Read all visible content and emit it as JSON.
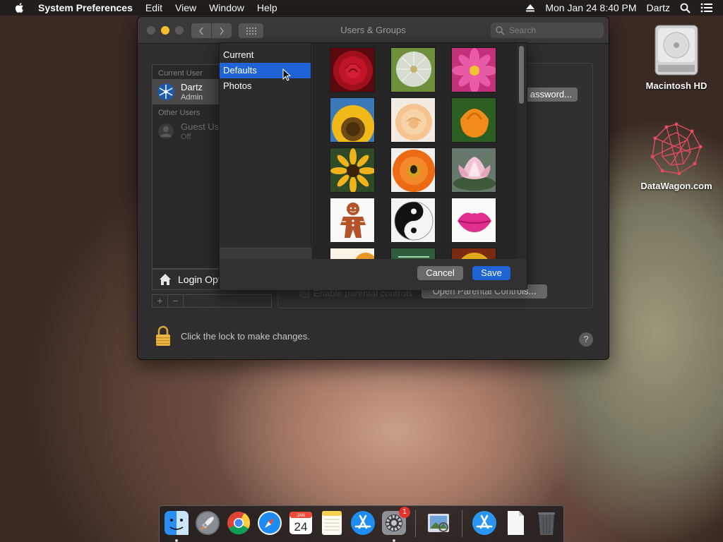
{
  "menubar": {
    "app": "System Preferences",
    "items": [
      "Edit",
      "View",
      "Window",
      "Help"
    ],
    "datetime": "Mon Jan 24  8:40 PM",
    "user": "Dartz"
  },
  "window": {
    "title": "Users & Groups",
    "search_placeholder": "Search"
  },
  "userlist": {
    "current_header": "Current User",
    "current_user": {
      "name": "Dartz",
      "role": "Admin"
    },
    "other_header": "Other Users",
    "guest": {
      "name": "Guest Us",
      "status": "Off"
    },
    "login_options": "Login Opt"
  },
  "main": {
    "password_button": "assword...",
    "parental_checkbox": "Enable parental controls",
    "parental_button": "Open Parental Controls..."
  },
  "lock": {
    "text": "Click the lock to make changes."
  },
  "picker": {
    "categories": [
      "Current",
      "Defaults",
      "Photos"
    ],
    "selected_category": "Defaults",
    "images": [
      "red rose",
      "dandelion",
      "pink dahlia",
      "sunflower",
      "peach rose",
      "orange poppy",
      "black-eyed susan",
      "orange gerbera",
      "pink lotus",
      "gingerbread man",
      "yin yang",
      "lips",
      "partial",
      "partial",
      "partial"
    ],
    "cancel": "Cancel",
    "save": "Save"
  },
  "desktop": {
    "icons": [
      "Macintosh HD",
      "DataWagon.com"
    ]
  },
  "dock": {
    "apps": [
      "Finder",
      "Launchpad",
      "Chrome",
      "Safari",
      "Calendar",
      "Notes",
      "App Store",
      "System Preferences",
      "Preview",
      "App Store Folder",
      "Document",
      "Trash"
    ],
    "calendar_month": "JAN",
    "calendar_day": "24",
    "badge": "1"
  },
  "colors": {
    "accent": "#1f63d6",
    "window_bg": "#2f2d2d"
  }
}
